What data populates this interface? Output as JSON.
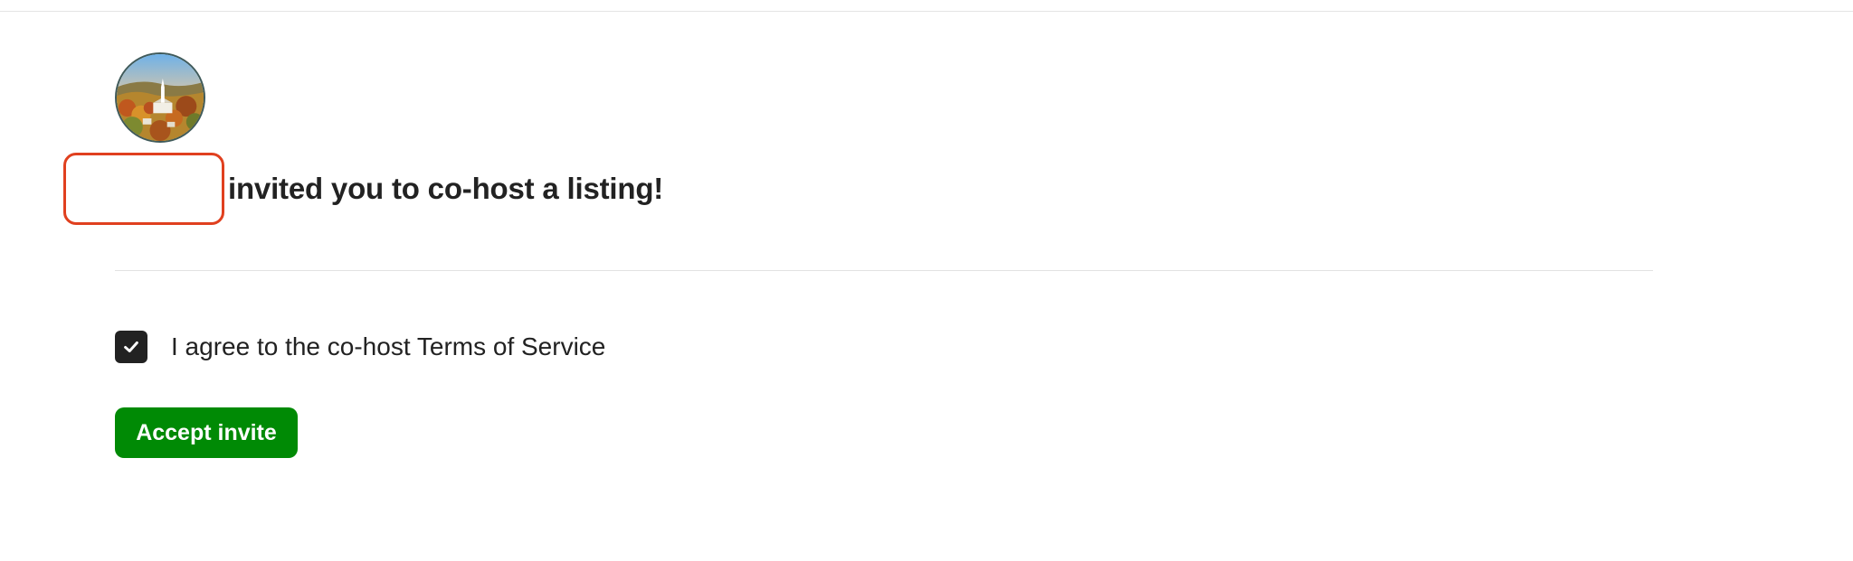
{
  "invitation": {
    "inviter_name": "",
    "headline": "invited you to co-host a listing!",
    "avatar_icon": "landscape-photo-avatar"
  },
  "terms": {
    "checked": true,
    "label": "I agree to the co-host Terms of Service"
  },
  "actions": {
    "accept_label": "Accept invite"
  },
  "colors": {
    "accept_button": "#008a05",
    "highlight_border": "#e0401f",
    "checkbox": "#222222",
    "text": "#222222"
  }
}
